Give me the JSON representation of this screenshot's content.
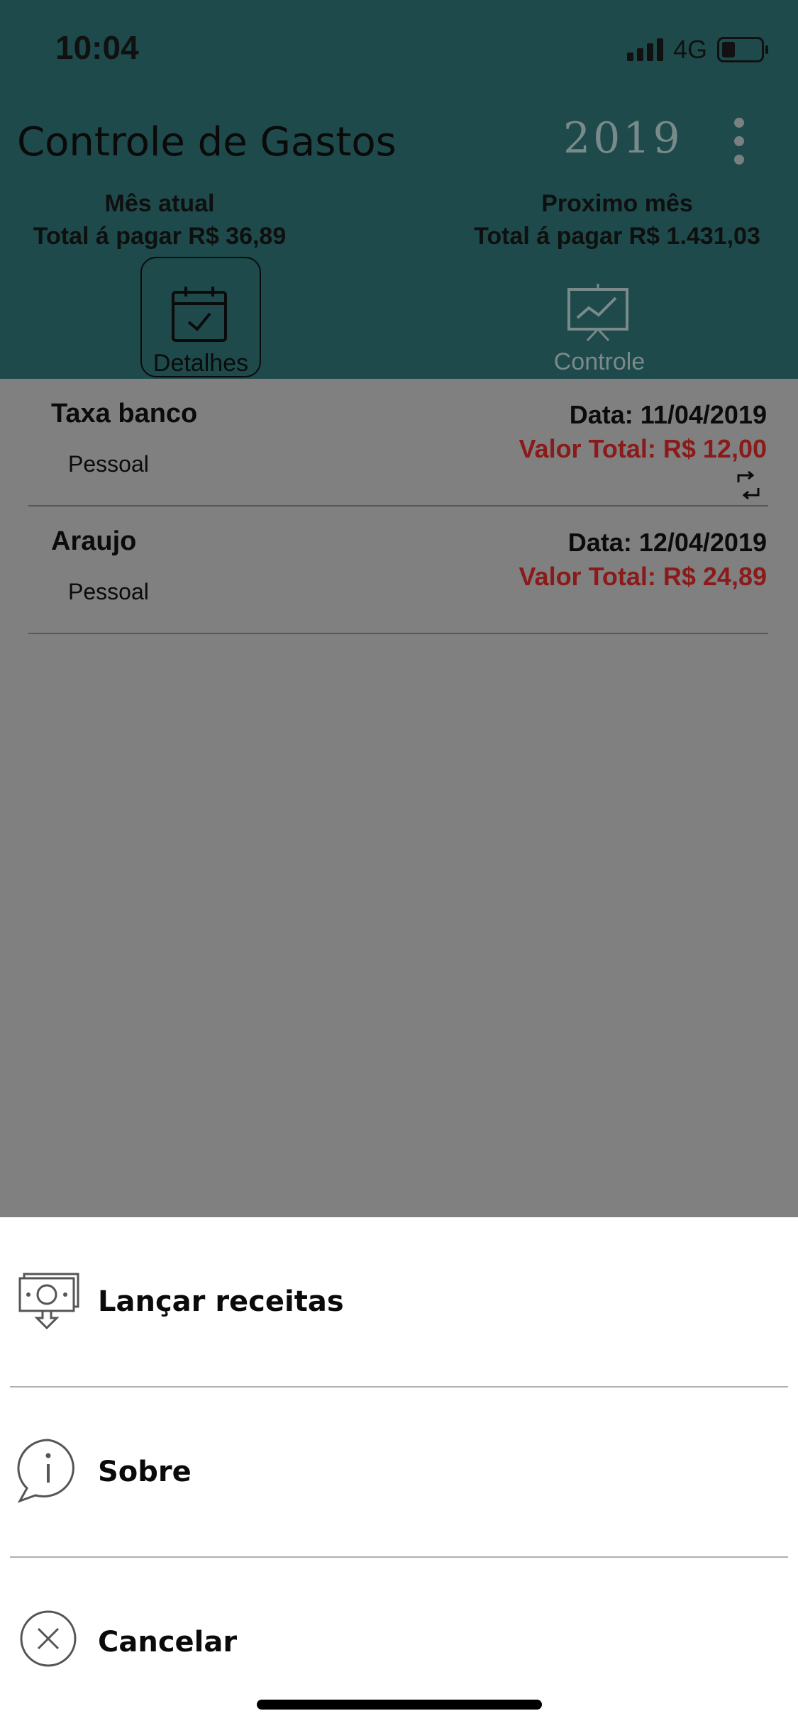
{
  "status": {
    "time": "10:04",
    "network": "4G"
  },
  "header": {
    "title": "Controle de Gastos",
    "year": "2019",
    "current_month": {
      "label": "Mês atual",
      "total": "Total á pagar  R$ 36,89"
    },
    "next_month": {
      "label": "Proximo mês",
      "total": "Total á pagar  R$ 1.431,03"
    },
    "tabs": [
      {
        "label": "Detalhes",
        "icon": "calendar-check-icon",
        "selected": true
      },
      {
        "label": "Controle",
        "icon": "presentation-chart-icon",
        "selected": false
      }
    ]
  },
  "expenses": [
    {
      "name": "Taxa banco",
      "category": "Pessoal",
      "date": "Data: 11/04/2019",
      "value": "Valor Total: R$ 12,00",
      "recurring": true
    },
    {
      "name": "Araujo",
      "category": "Pessoal",
      "date": "Data: 12/04/2019",
      "value": "Valor Total: R$ 24,89",
      "recurring": false
    }
  ],
  "sheet": {
    "items": [
      {
        "label": "Lançar receitas",
        "icon": "money-download-icon"
      },
      {
        "label": "Sobre",
        "icon": "info-bubble-icon"
      },
      {
        "label": "Cancelar",
        "icon": "close-circle-icon"
      }
    ]
  },
  "colors": {
    "header": "#1e4a4b",
    "overlay": "#808080",
    "value_red": "#8b1a1a"
  }
}
